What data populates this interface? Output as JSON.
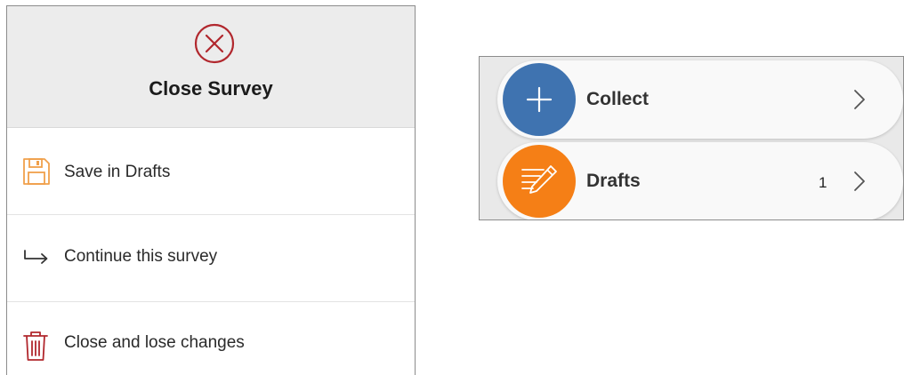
{
  "dialog": {
    "title": "Close Survey",
    "header_icon": "close-circle-icon",
    "options": [
      {
        "label": "Save in Drafts",
        "icon": "save-icon",
        "icon_color": "#f0a04b"
      },
      {
        "label": "Continue this survey",
        "icon": "return-arrow-icon",
        "icon_color": "#333333"
      },
      {
        "label": "Close and lose changes",
        "icon": "trash-icon",
        "icon_color": "#b1272d"
      }
    ]
  },
  "survey_list": {
    "items": [
      {
        "label": "Collect",
        "icon": "plus-icon",
        "color": "#3f73b0",
        "count": ""
      },
      {
        "label": "Drafts",
        "icon": "pencil-note-icon",
        "color": "#f57f16",
        "count": "1"
      }
    ]
  },
  "colors": {
    "close_icon": "#b1272d",
    "header_bg": "#ececec"
  }
}
